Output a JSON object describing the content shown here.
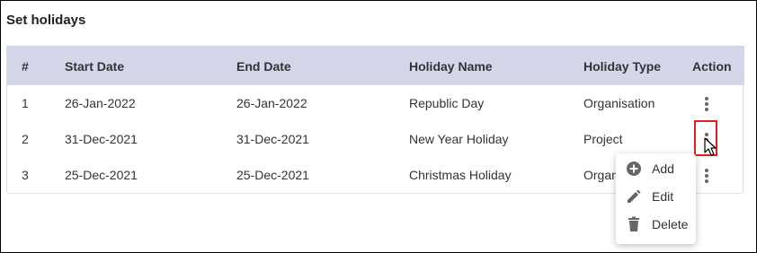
{
  "page": {
    "title": "Set holidays"
  },
  "table": {
    "headers": {
      "num": "#",
      "start_date": "Start Date",
      "end_date": "End Date",
      "holiday_name": "Holiday Name",
      "holiday_type": "Holiday Type",
      "action": "Action"
    },
    "rows": [
      {
        "num": "1",
        "start_date": "26-Jan-2022",
        "end_date": "26-Jan-2022",
        "holiday_name": "Republic Day",
        "holiday_type": "Organisation"
      },
      {
        "num": "2",
        "start_date": "31-Dec-2021",
        "end_date": "31-Dec-2021",
        "holiday_name": "New Year Holiday",
        "holiday_type": "Project"
      },
      {
        "num": "3",
        "start_date": "25-Dec-2021",
        "end_date": "25-Dec-2021",
        "holiday_name": "Christmas Holiday",
        "holiday_type": "Organ"
      }
    ],
    "action_icon": "more-vertical-icon"
  },
  "context_menu": {
    "items": [
      {
        "label": "Add",
        "icon": "add-circle-icon"
      },
      {
        "label": "Edit",
        "icon": "pencil-icon"
      },
      {
        "label": "Delete",
        "icon": "trash-icon"
      }
    ]
  },
  "colors": {
    "header_bg": "#d4d6ea",
    "highlight": "#e02020",
    "icon": "#666666"
  }
}
